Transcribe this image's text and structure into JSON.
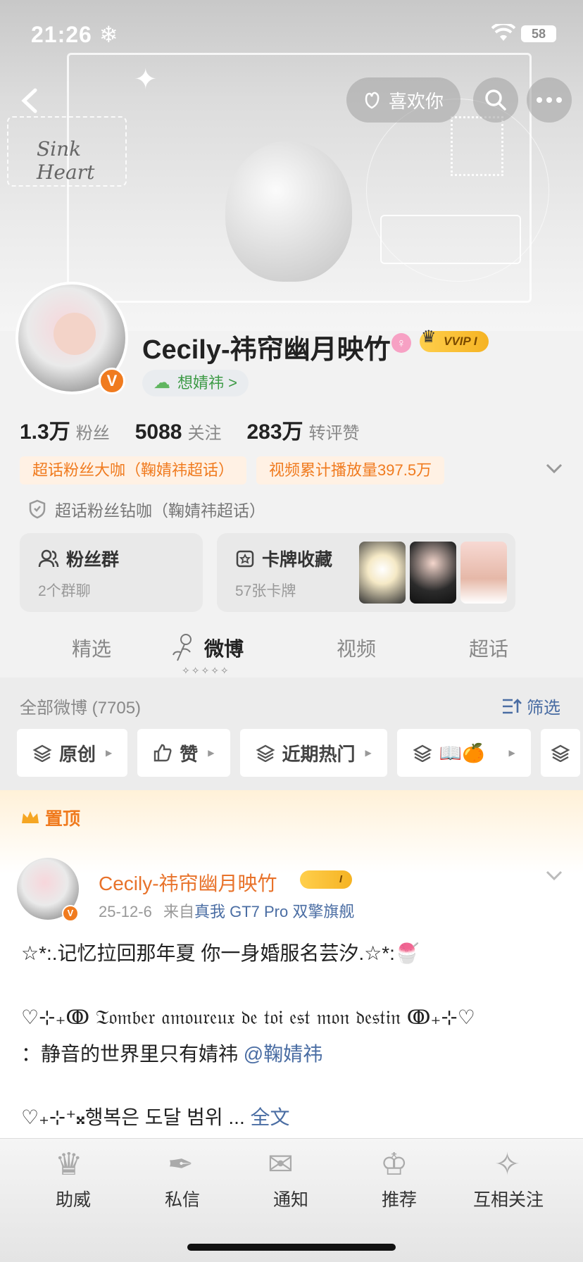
{
  "status_bar": {
    "time": "21:26 ❄",
    "battery": "58"
  },
  "header": {
    "like_label": "喜欢你",
    "banner_script": "Sink Heart"
  },
  "profile": {
    "name": "Cecily-祎帘幽月映竹",
    "vip_label": "VVIP I",
    "fan_tag": "想婧祎 >",
    "stats": [
      {
        "num": "1.3万",
        "label": "粉丝"
      },
      {
        "num": "5088",
        "label": "关注"
      },
      {
        "num": "283万",
        "label": "转评赞"
      }
    ],
    "honors": [
      "超话粉丝大咖（鞠婧祎超话）",
      "视频累计播放量397.5万"
    ],
    "honor2": "超话粉丝钻咖（鞠婧祎超话）",
    "cards": {
      "fans_title": "粉丝群",
      "fans_sub": "2个群聊",
      "collect_title": "卡牌收藏",
      "collect_sub": "57张卡牌"
    }
  },
  "tabs": [
    "精选",
    "微博",
    "视频",
    "超话"
  ],
  "active_tab": "微博",
  "tab_deco": "✧✧✧✧✧",
  "feed": {
    "all_label": "全部微博 (7705)",
    "filter_label": "筛选",
    "chips": [
      "原创",
      "赞",
      "近期热门",
      "📖🍊"
    ]
  },
  "post": {
    "pinned_label": "置顶",
    "author": "Cecily-祎帘幽月映竹",
    "vip": "I",
    "date": "25-12-6",
    "source_prefix": "来自",
    "device": "真我 GT7 Pro 双擎旗舰",
    "line1": "☆*:.记忆拉回那年夏 你一身婚服名芸汐.☆*:🍧",
    "line2": "♡⊹₊ↂ 𝔗𝔬𝔪𝔟𝔢𝔯 𝔞𝔪𝔬𝔲𝔯𝔢𝔲𝔵 𝔡𝔢 𝔱𝔬𝔦 𝔢𝔰𝔱 𝔪𝔬𝔫 𝔡𝔢𝔰𝔱𝔦𝔫 ↂ₊⊹♡",
    "line3_text": "：静音的世界里只有婧祎 ",
    "line3_mention": "@鞠婧祎",
    "line4_text": "♡₊⊹⁺𝄪행복은 도달 범위 ... ",
    "line4_more": "全文"
  },
  "bottom_nav": [
    "助威",
    "私信",
    "通知",
    "推荐",
    "互相关注"
  ],
  "colors": {
    "accent": "#f07b1f",
    "link": "#4a6da3",
    "vip": "#f5b323"
  }
}
